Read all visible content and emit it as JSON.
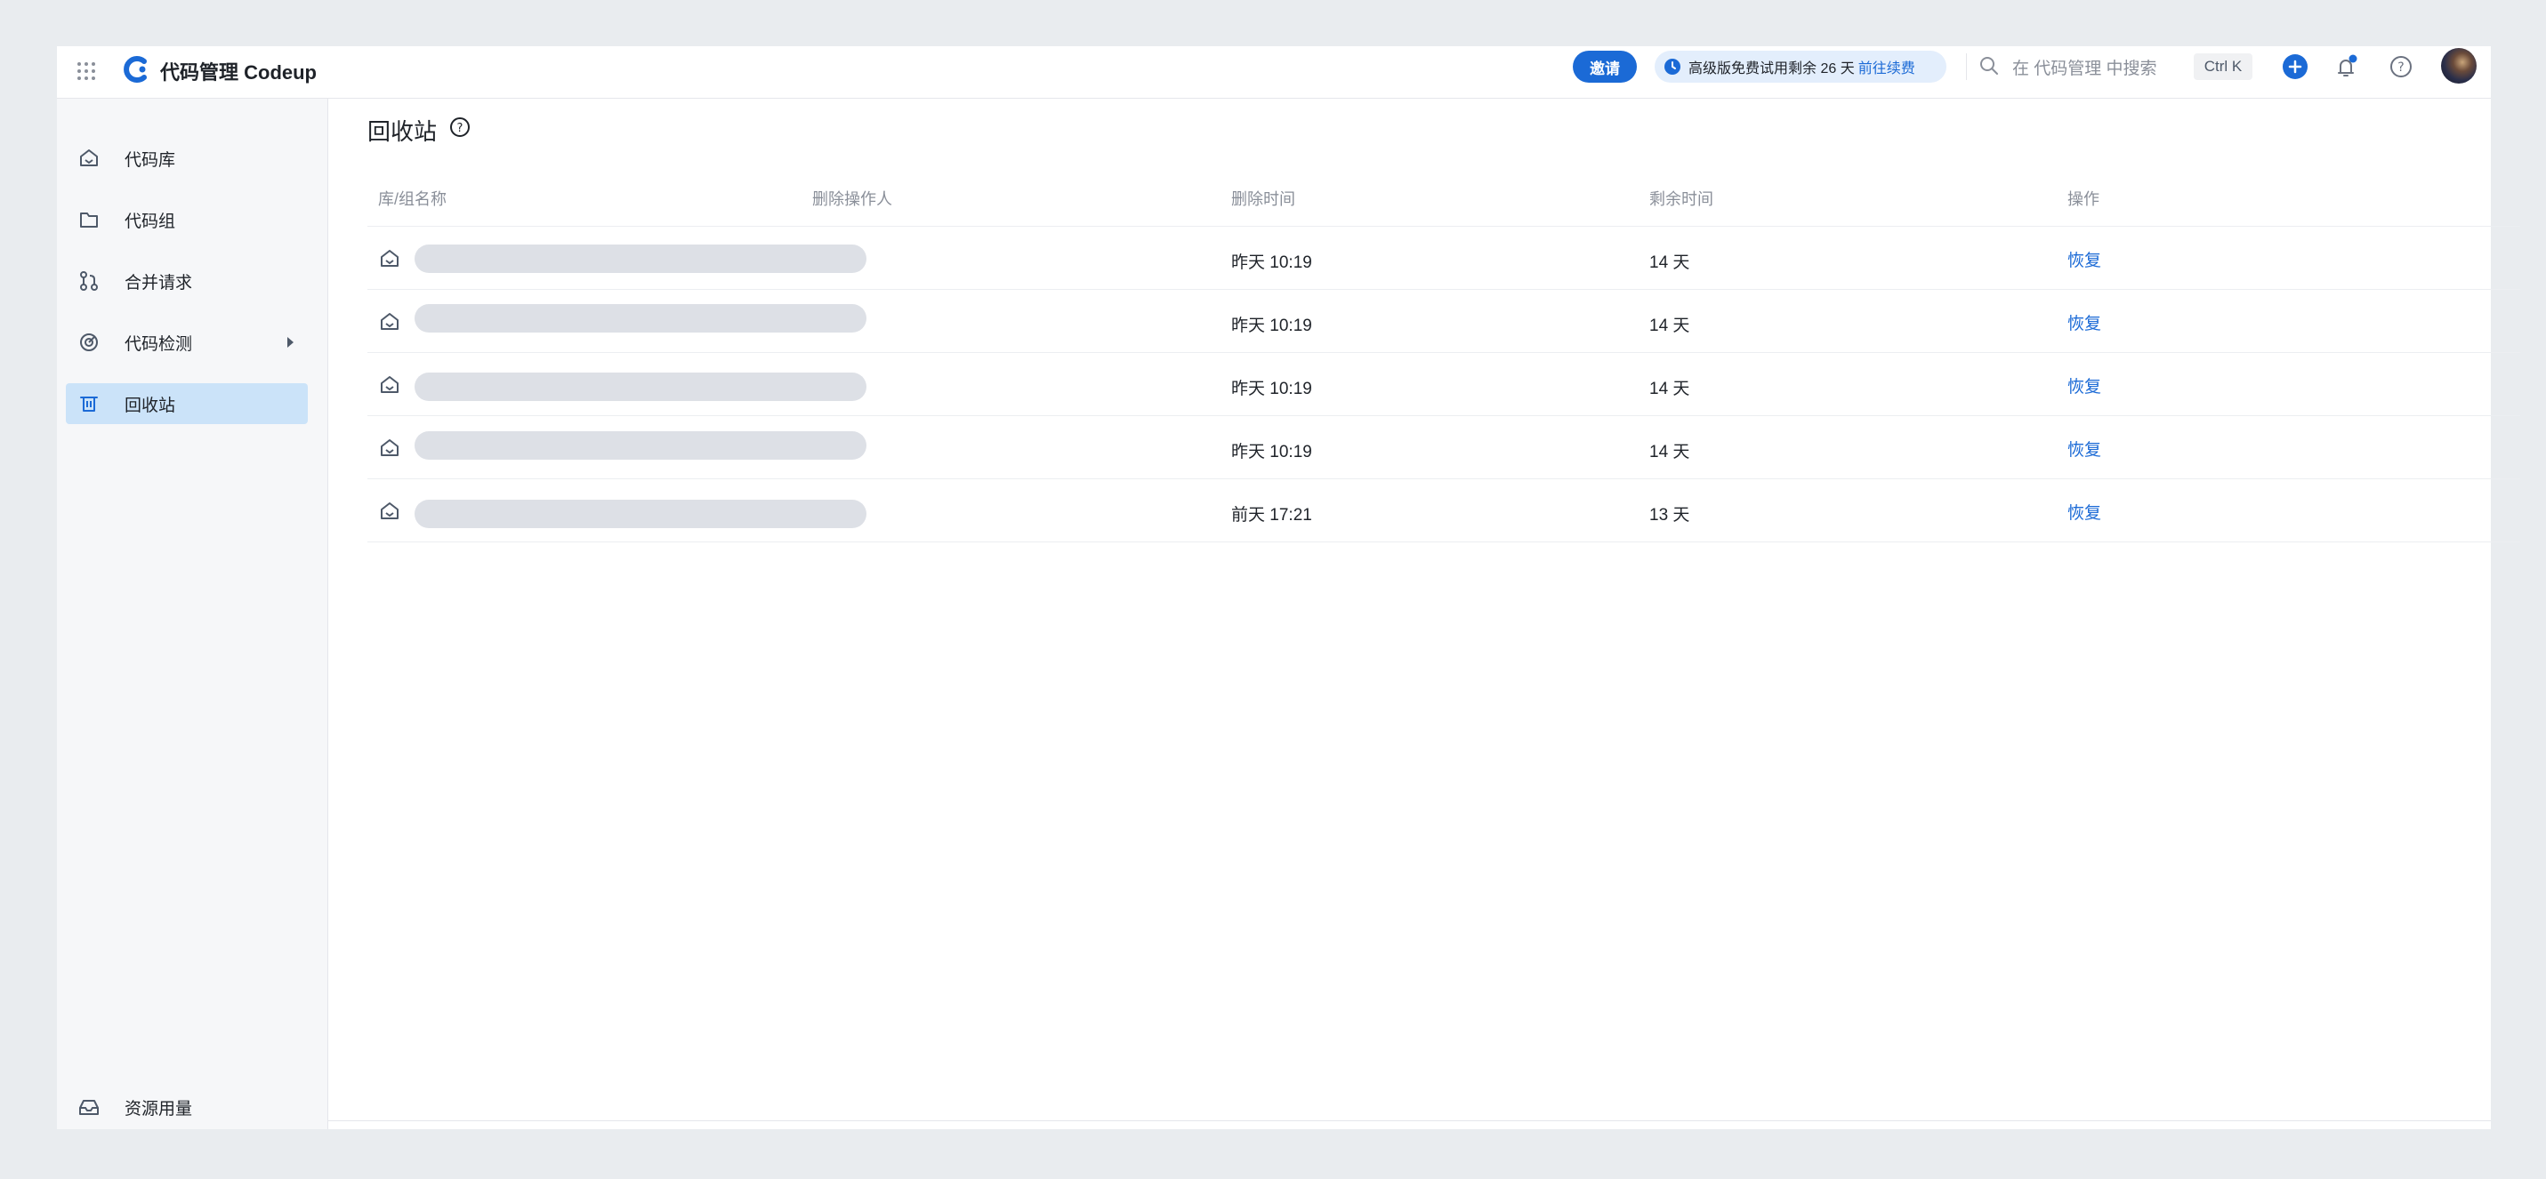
{
  "header": {
    "app_title": "代码管理 Codeup",
    "invite_label": "邀请",
    "trial_text": "高级版免费试用剩余 26 天",
    "trial_link": "前往续费",
    "search_placeholder": "在 代码管理 中搜索",
    "search_shortcut": "Ctrl K"
  },
  "sidebar": {
    "items": [
      {
        "label": "代码库",
        "icon": "repo-icon"
      },
      {
        "label": "代码组",
        "icon": "folder-icon"
      },
      {
        "label": "合并请求",
        "icon": "merge-request-icon"
      },
      {
        "label": "代码检测",
        "icon": "scan-icon"
      },
      {
        "label": "回收站",
        "icon": "trash-icon",
        "active": true
      }
    ],
    "bottom_item": {
      "label": "资源用量",
      "icon": "inbox-icon"
    }
  },
  "main": {
    "title": "回收站",
    "columns": [
      "库/组名称",
      "删除操作人",
      "删除时间",
      "剩余时间",
      "操作"
    ],
    "rows": [
      {
        "deleted_time": "昨天 10:19",
        "remaining": "14 天",
        "action": "恢复"
      },
      {
        "deleted_time": "昨天 10:19",
        "remaining": "14 天",
        "action": "恢复"
      },
      {
        "deleted_time": "昨天 10:19",
        "remaining": "14 天",
        "action": "恢复"
      },
      {
        "deleted_time": "昨天 10:19",
        "remaining": "14 天",
        "action": "恢复"
      },
      {
        "deleted_time": "前天 17:21",
        "remaining": "13 天",
        "action": "恢复"
      }
    ]
  },
  "colors": {
    "accent": "#1b6ad6",
    "active_nav": "#cbe3f9",
    "placeholder_bar": "#dde0e6"
  }
}
